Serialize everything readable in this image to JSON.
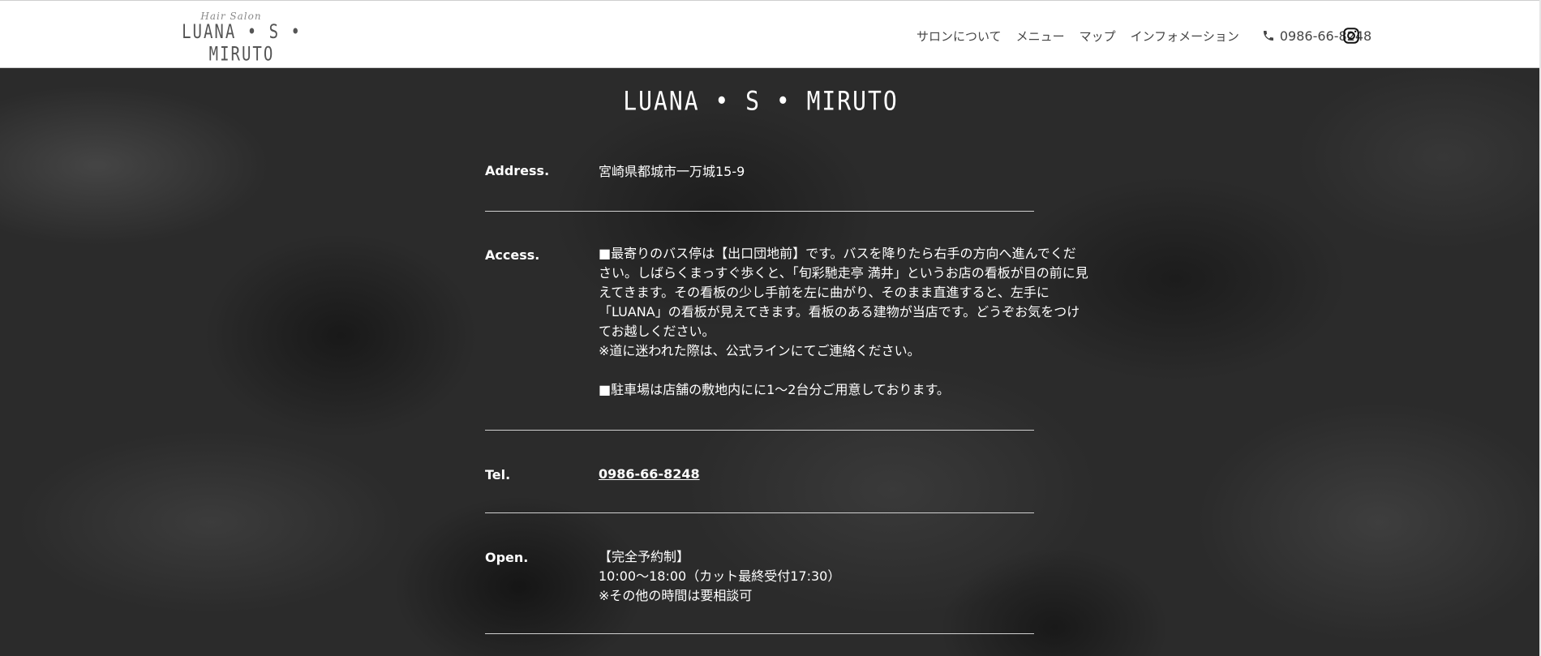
{
  "header": {
    "logo_small": "Hair Salon",
    "logo_main": "LUANA • S • MIRUTO",
    "nav": [
      "サロンについて",
      "メニュー",
      "マップ",
      "インフォメーション"
    ],
    "phone": "0986-66-8248",
    "phone_icon": "phone-icon",
    "instagram_icon": "instagram-icon"
  },
  "main": {
    "title": "LUANA • S • MIRUTO",
    "rows": {
      "address": {
        "label": "Address.",
        "value": "宮崎県都城市一万城15-9"
      },
      "access": {
        "label": "Access.",
        "lines": [
          "■最寄りのバス停は【出口団地前】です。バスを降りたら右手の方向へ進んでくだ",
          "さい。しばらくまっすぐ歩くと、「旬彩馳走亭 満井」というお店の看板が目の前に見",
          "えてきます。その看板の少し手前を左に曲がり、そのまま直進すると、左手に",
          "「LUANA」の看板が見えてきます。看板のある建物が当店です。どうぞお気をつけ",
          "てお越しください。",
          "※道に迷われた際は、公式ラインにてご連絡ください。",
          "■駐車場は店舗の敷地内にに1〜2台分ご用意しております。"
        ]
      },
      "tel": {
        "label": "Tel.",
        "value": "0986-66-8248"
      },
      "open": {
        "label": "Open.",
        "lines": [
          "【完全予約制】",
          "10:00〜18:00（カット最終受付17:30）",
          "※その他の時間は要相談可"
        ]
      }
    }
  },
  "colors": {
    "header_bg": "#ffffff",
    "page_bg": "#2b2b2b",
    "text_light": "#ffffff",
    "nav_text": "#444444"
  }
}
